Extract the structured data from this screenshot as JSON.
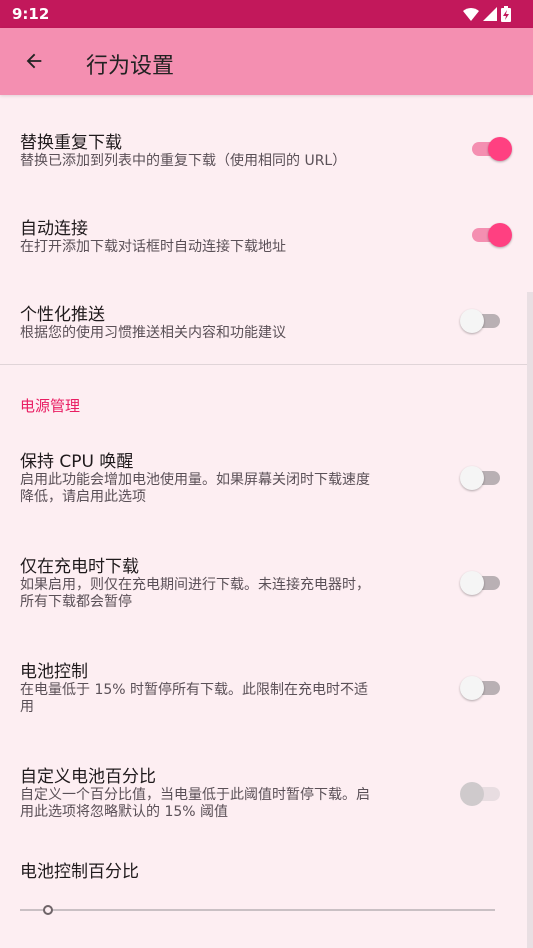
{
  "status_bar": {
    "time": "9:12"
  },
  "app_bar": {
    "title": "行为设置"
  },
  "settings": [
    {
      "title": "替换重复下载",
      "subtitle": "替换已添加到列表中的重复下载（使用相同的 URL）",
      "state": "on"
    },
    {
      "title": "自动连接",
      "subtitle": "在打开添加下载对话框时自动连接下载地址",
      "state": "on"
    },
    {
      "title": "个性化推送",
      "subtitle": "根据您的使用习惯推送相关内容和功能建议",
      "state": "off"
    }
  ],
  "power_section": {
    "header": "电源管理",
    "items": [
      {
        "title": "保持 CPU 唤醒",
        "subtitle_line1": "启用此功能会增加电池使用量。如果屏幕关闭时下载速度",
        "subtitle_line2": "降低，请启用此选项",
        "state": "off"
      },
      {
        "title": "仅在充电时下载",
        "subtitle_line1": "如果启用，则仅在充电期间进行下载。未连接充电器时，",
        "subtitle_line2": "所有下载都会暂停",
        "state": "off"
      },
      {
        "title": "电池控制",
        "subtitle_line1": "在电量低于 15% 时暂停所有下载。此限制在充电时不适",
        "subtitle_line2": "用",
        "state": "off"
      },
      {
        "title": "自定义电池百分比",
        "subtitle_line1": "自定义一个百分比值，当电量低于此阈值时暂停下载。启",
        "subtitle_line2": "用此选项将忽略默认的 15% 阈值",
        "state": "disabled"
      }
    ],
    "slider": {
      "title": "电池控制百分比",
      "value_fraction": 0.06
    }
  },
  "colors": {
    "status_bar": "#c2185b",
    "app_bar": "#f48fb1",
    "background": "#fdeef2",
    "accent": "#ff4081",
    "section_header": "#e91e63"
  },
  "icons": {
    "back": "arrow-left-icon",
    "wifi": "wifi-icon",
    "signal": "signal-icon",
    "battery": "battery-charging-icon"
  }
}
